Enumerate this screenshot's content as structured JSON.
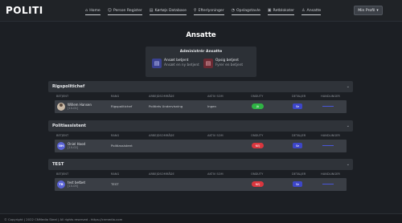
{
  "brand": {
    "logo": "POLITI"
  },
  "nav": [
    {
      "icon": "home-icon",
      "glyph": "⌂",
      "label": "Home"
    },
    {
      "icon": "person-icon",
      "glyph": "☺",
      "label": "Person Register"
    },
    {
      "icon": "database-icon",
      "glyph": "▤",
      "label": "Kørtøjs Database"
    },
    {
      "icon": "search-icon",
      "glyph": "⚲",
      "label": "Efterlysninger"
    },
    {
      "icon": "stats-icon",
      "glyph": "◔",
      "label": "Opslagstavle"
    },
    {
      "icon": "report-icon",
      "glyph": "▣",
      "label": "Retblokater"
    },
    {
      "icon": "employees-icon",
      "glyph": "♙",
      "label": "Ansatte"
    }
  ],
  "profile": {
    "label": "Min Profil"
  },
  "page": {
    "title": "Ansatte"
  },
  "admin": {
    "title": "Administrér Ansatte",
    "hire": {
      "title": "Ansæt betjent",
      "subtitle": "Ansæt en ny betjent"
    },
    "fire": {
      "title": "Opsig betjent",
      "subtitle": "Fyrer en betjent"
    }
  },
  "columns": {
    "betjent": "Betjent",
    "rank": "Rang",
    "grouping": "Arbejdsområde",
    "unit": "Aktiv som",
    "status": "Onduty",
    "details": "Detaljer",
    "actions": "Handlinger"
  },
  "sections": [
    {
      "title": "Rigspolitichef",
      "rows": [
        {
          "name": "Willem Hansen",
          "id": "[10-01]",
          "rank": "Rigspolitichef",
          "grouping": "Politiets Undervisning",
          "unit": "Ingen",
          "status": "JA",
          "details": "Se",
          "avatar": ""
        }
      ]
    },
    {
      "title": "Politiassistent",
      "rows": [
        {
          "name": "Oniel Hood",
          "id": "[10-02]",
          "rank": "Politiassistent",
          "grouping": "",
          "unit": "",
          "status": "NEJ",
          "details": "Se",
          "avatar": "OH"
        }
      ]
    },
    {
      "title": "TEST",
      "rows": [
        {
          "name": "test betbet",
          "id": "[10-05]",
          "rank": "TEST",
          "grouping": "",
          "unit": "",
          "status": "NEJ",
          "details": "Se",
          "avatar": "TB"
        }
      ]
    }
  ],
  "footer": {
    "text": "© Copyright | 2022 CNMedia Steel | All rights reserved - https://cnmedia.com"
  },
  "colors": {
    "background": "#1c1f24",
    "accent": "#3d46c8",
    "on": "#2fb344",
    "off": "#d9363e"
  }
}
